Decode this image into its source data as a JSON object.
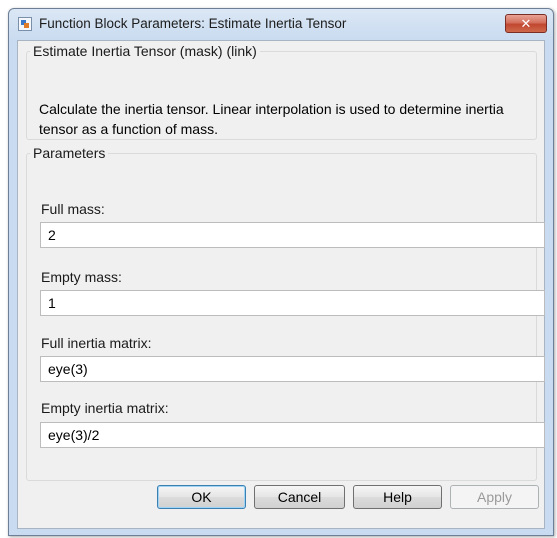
{
  "window": {
    "title": "Function Block Parameters: Estimate Inertia Tensor",
    "close_label": "✕"
  },
  "description": {
    "group_title": "Estimate Inertia Tensor (mask) (link)",
    "text": "Calculate the inertia tensor.  Linear interpolation is used to determine inertia tensor as a function of mass."
  },
  "parameters": {
    "group_title": "Parameters",
    "fields": [
      {
        "label": "Full mass:",
        "value": "2"
      },
      {
        "label": "Empty mass:",
        "value": "1"
      },
      {
        "label": "Full inertia matrix:",
        "value": "eye(3)"
      },
      {
        "label": "Empty inertia matrix:",
        "value": "eye(3)/2"
      }
    ]
  },
  "buttons": {
    "ok": "OK",
    "cancel": "Cancel",
    "help": "Help",
    "apply": "Apply"
  }
}
